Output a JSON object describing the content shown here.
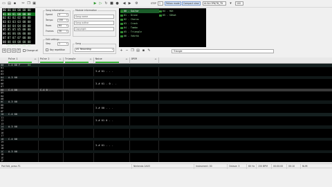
{
  "toolbar": {
    "step_label": "STEP",
    "step_value": "1",
    "follow_label": "Fallow mode",
    "compact_label": "Compact view",
    "device_value": "ALSA:OPN/TB_TB",
    "zoom_value": "100"
  },
  "orders": {
    "rows": [
      {
        "num": "00",
        "cells": "00 00 00 00 00"
      },
      {
        "num": "01",
        "cells": "00 01 00 00 00"
      },
      {
        "num": "02",
        "cells": "02 02 02 00 00"
      },
      {
        "num": "03",
        "cells": "03 03 03 00 00"
      },
      {
        "num": "04",
        "cells": "04 04 04 00 00"
      },
      {
        "num": "05",
        "cells": "05 05 05 00 00"
      },
      {
        "num": "06",
        "cells": "06 06 06 00 00"
      },
      {
        "num": "07",
        "cells": "07 07 07 00 00"
      },
      {
        "num": "08",
        "cells": "08 08 08 00 00"
      },
      {
        "num": "09",
        "cells": "09 09 09 00 00"
      }
    ],
    "change_all_label": "Change all"
  },
  "song_info": {
    "title": "Song information",
    "fields": [
      {
        "label": "Speed",
        "value": "4"
      },
      {
        "label": "Tempo",
        "value": "150"
      },
      {
        "label": "Rows",
        "value": "64"
      },
      {
        "label": "Frames",
        "value": "30"
      }
    ]
  },
  "module_info": {
    "title": "Module information",
    "name_placeholder": "Song name",
    "author_placeholder": "Song author",
    "copyright_placeholder": "Copyright"
  },
  "edit_settings": {
    "title": "Edit settings",
    "step_label": "Step",
    "step_value": "1",
    "keyrepeat_label": "Key repetition"
  },
  "song_select": {
    "title": "Song",
    "value": "#1 Recording"
  },
  "instruments": {
    "col1": [
      "00 - Guitar",
      "01 - Drone",
      "02 - Chorus",
      "03 - Crash",
      "04 - Tambo",
      "05 - Triangle",
      "06 - Vokrkk"
    ],
    "col2": [
      "04 - Hat",
      "05 - SDhat"
    ],
    "selected": 0,
    "name_value": "Triangle"
  },
  "channels": [
    {
      "name": "Pulse 1"
    },
    {
      "name": "Pulse 2"
    },
    {
      "name": "Triangle"
    },
    {
      "name": "Noise"
    },
    {
      "name": "DPCM"
    }
  ],
  "pattern_rows": [
    {
      "n": "00",
      "c": [
        [
          "C-4 00 F",
          "04"
        ],
        [
          "",
          ""
        ],
        [
          "",
          ""
        ],
        [
          "",
          ""
        ],
        [
          "",
          ""
        ]
      ]
    },
    {
      "n": "01",
      "c": [
        [
          "",
          ""
        ],
        [
          "",
          ""
        ],
        [
          "",
          ""
        ],
        [
          "",
          ""
        ],
        [
          "",
          ""
        ]
      ]
    },
    {
      "n": "02",
      "c": [
        [
          "",
          ""
        ],
        [
          "",
          ""
        ],
        [
          "",
          ""
        ],
        [
          "3-# 01 . . .",
          ""
        ],
        [
          "",
          ""
        ]
      ]
    },
    {
      "n": "03",
      "c": [
        [
          "",
          ""
        ],
        [
          "",
          ""
        ],
        [
          "",
          ""
        ],
        [
          "",
          ""
        ],
        [
          "",
          ""
        ]
      ]
    },
    {
      "n": "04",
      "c": [
        [
          "A-3 00",
          ""
        ],
        [
          "",
          ""
        ],
        [
          "",
          ""
        ],
        [
          "",
          ""
        ],
        [
          "",
          ""
        ]
      ]
    },
    {
      "n": "05",
      "c": [
        [
          "",
          ""
        ],
        [
          "",
          ""
        ],
        [
          "",
          ""
        ],
        [
          "",
          ""
        ],
        [
          "",
          ""
        ]
      ]
    },
    {
      "n": "06",
      "c": [
        [
          "",
          ""
        ],
        [
          "",
          ""
        ],
        [
          "",
          ""
        ],
        [
          "3-# 01 . 0 . .",
          ""
        ],
        [
          "",
          ""
        ]
      ]
    },
    {
      "n": "07",
      "c": [
        [
          "",
          ""
        ],
        [
          "",
          ""
        ],
        [
          "",
          ""
        ],
        [
          "",
          ""
        ],
        [
          "",
          ""
        ]
      ]
    },
    {
      "n": "08",
      "c": [
        [
          "C-4 00",
          ""
        ],
        [
          "C-4 0 .",
          ""
        ],
        [
          "",
          ""
        ],
        [
          "",
          ""
        ],
        [
          "",
          ""
        ]
      ]
    },
    {
      "n": "09",
      "c": [
        [
          "",
          ""
        ],
        [
          "",
          ""
        ],
        [
          "",
          ""
        ],
        [
          "",
          ""
        ],
        [
          "",
          ""
        ]
      ]
    },
    {
      "n": "0A",
      "c": [
        [
          "",
          ""
        ],
        [
          "",
          ""
        ],
        [
          "",
          ""
        ],
        [
          "",
          ""
        ],
        [
          "",
          ""
        ]
      ]
    },
    {
      "n": "0B",
      "c": [
        [
          "",
          ""
        ],
        [
          "",
          ""
        ],
        [
          "",
          ""
        ],
        [
          "",
          ""
        ],
        [
          "",
          ""
        ]
      ]
    },
    {
      "n": "0C",
      "c": [
        [
          "A-3 00",
          ""
        ],
        [
          "",
          ""
        ],
        [
          "",
          ""
        ],
        [
          "",
          ""
        ],
        [
          "",
          ""
        ]
      ]
    },
    {
      "n": "0D",
      "c": [
        [
          "",
          ""
        ],
        [
          "",
          ""
        ],
        [
          "",
          ""
        ],
        [
          "",
          ""
        ],
        [
          "",
          ""
        ]
      ]
    },
    {
      "n": "0E",
      "c": [
        [
          "",
          ""
        ],
        [
          "",
          ""
        ],
        [
          "",
          ""
        ],
        [
          "3-# 00 . . .",
          ""
        ],
        [
          "",
          ""
        ]
      ]
    },
    {
      "n": "0F",
      "c": [
        [
          "",
          ""
        ],
        [
          "",
          ""
        ],
        [
          "",
          ""
        ],
        [
          "",
          ""
        ],
        [
          "",
          ""
        ]
      ]
    },
    {
      "n": "10",
      "c": [
        [
          "C-4 00",
          ""
        ],
        [
          "",
          ""
        ],
        [
          "",
          ""
        ],
        [
          "",
          ""
        ],
        [
          "",
          ""
        ]
      ]
    },
    {
      "n": "11",
      "c": [
        [
          "",
          ""
        ],
        [
          "",
          ""
        ],
        [
          "",
          ""
        ],
        [
          "",
          ""
        ],
        [
          "",
          ""
        ]
      ]
    },
    {
      "n": "12",
      "c": [
        [
          "",
          ""
        ],
        [
          "",
          ""
        ],
        [
          "",
          ""
        ],
        [
          "3-# 01 0 . .",
          ""
        ],
        [
          "",
          ""
        ]
      ]
    },
    {
      "n": "13",
      "c": [
        [
          "",
          ""
        ],
        [
          "",
          ""
        ],
        [
          "",
          ""
        ],
        [
          "",
          ""
        ],
        [
          "",
          ""
        ]
      ]
    },
    {
      "n": "14",
      "c": [
        [
          "A-3 00",
          ""
        ],
        [
          "",
          ""
        ],
        [
          "",
          ""
        ],
        [
          "",
          ""
        ],
        [
          "",
          ""
        ]
      ]
    },
    {
      "n": "15",
      "c": [
        [
          "",
          ""
        ],
        [
          "",
          ""
        ],
        [
          "",
          ""
        ],
        [
          "",
          ""
        ],
        [
          "",
          ""
        ]
      ]
    },
    {
      "n": "16",
      "c": [
        [
          "",
          ""
        ],
        [
          "",
          ""
        ],
        [
          "",
          ""
        ],
        [
          "",
          ""
        ],
        [
          "",
          ""
        ]
      ]
    },
    {
      "n": "17",
      "c": [
        [
          "",
          ""
        ],
        [
          "",
          ""
        ],
        [
          "",
          ""
        ],
        [
          "",
          ""
        ],
        [
          "",
          ""
        ]
      ]
    },
    {
      "n": "18",
      "c": [
        [
          "C-4 00",
          ""
        ],
        [
          "",
          ""
        ],
        [
          "",
          ""
        ],
        [
          "",
          ""
        ],
        [
          "",
          ""
        ]
      ]
    },
    {
      "n": "19",
      "c": [
        [
          "",
          ""
        ],
        [
          "",
          ""
        ],
        [
          "",
          ""
        ],
        [
          "",
          ""
        ],
        [
          "",
          ""
        ]
      ]
    },
    {
      "n": "1A",
      "c": [
        [
          "",
          ""
        ],
        [
          "",
          ""
        ],
        [
          "",
          ""
        ],
        [
          "3-# 01 . . .",
          ""
        ],
        [
          "",
          ""
        ]
      ]
    },
    {
      "n": "1B",
      "c": [
        [
          "",
          ""
        ],
        [
          "",
          ""
        ],
        [
          "",
          ""
        ],
        [
          "",
          ""
        ],
        [
          "",
          ""
        ]
      ]
    },
    {
      "n": "1C",
      "c": [
        [
          "A-3 00",
          ""
        ],
        [
          "",
          ""
        ],
        [
          "",
          ""
        ],
        [
          "",
          ""
        ],
        [
          "",
          ""
        ]
      ]
    },
    {
      "n": "1D",
      "c": [
        [
          "",
          ""
        ],
        [
          "",
          ""
        ],
        [
          "",
          ""
        ],
        [
          "",
          ""
        ],
        [
          "",
          ""
        ]
      ]
    },
    {
      "n": "1E",
      "c": [
        [
          "",
          ""
        ],
        [
          "",
          ""
        ],
        [
          "",
          ""
        ],
        [
          "",
          ""
        ],
        [
          "",
          ""
        ]
      ]
    },
    {
      "n": "1F",
      "c": [
        [
          "",
          ""
        ],
        [
          "",
          ""
        ],
        [
          "",
          ""
        ],
        [
          "",
          ""
        ],
        [
          "",
          ""
        ]
      ]
    }
  ],
  "status": {
    "hint": "Pat Edit, press F1",
    "chip": "Nintendo 2A03",
    "instrument": "Instrument: 00",
    "octave": "Octave: 3",
    "rate": "60 Hz",
    "tempo": "150 BPM",
    "time": "00:00:00",
    "pos": "00:10",
    "mode": "NUM"
  }
}
